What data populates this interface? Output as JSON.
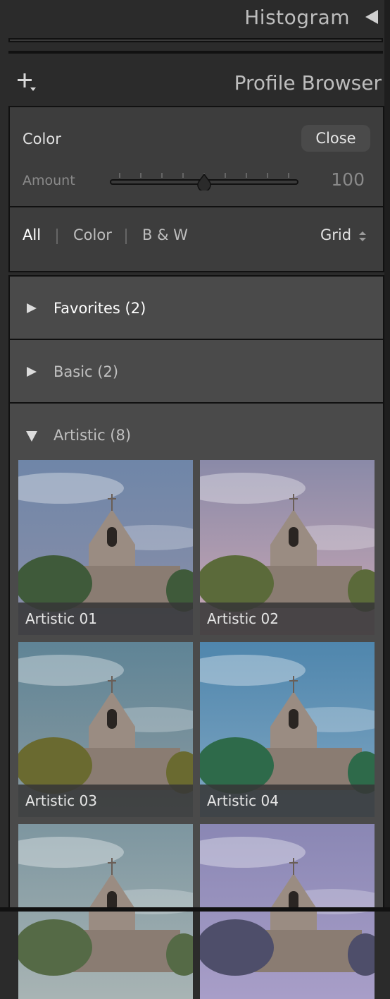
{
  "histogram": {
    "title": "Histogram"
  },
  "profile_browser": {
    "title": "Profile Browser",
    "current_profile": "Color",
    "close_label": "Close",
    "amount_label": "Amount",
    "amount_value": "100",
    "amount_fraction": 0.5,
    "filters": [
      "All",
      "Color",
      "B & W"
    ],
    "active_filter": "All",
    "view_mode": "Grid"
  },
  "groups": [
    {
      "label": "Favorites (2)",
      "expanded": false
    },
    {
      "label": "Basic (2)",
      "expanded": false
    },
    {
      "label": "Artistic (8)",
      "expanded": true
    }
  ],
  "thumbnails": [
    {
      "label": "Artistic 01",
      "sky": "#6f86a8",
      "tint": "#8b8fa8",
      "foliage": "#3f5a3a"
    },
    {
      "label": "Artistic 02",
      "sky": "#8a8aa8",
      "tint": "#c9a7b4",
      "foliage": "#5b6a3a"
    },
    {
      "label": "Artistic 03",
      "sky": "#5f8496",
      "tint": "#8a9aa0",
      "foliage": "#6a6a30"
    },
    {
      "label": "Artistic 04",
      "sky": "#4f86ad",
      "tint": "#7fa6c2",
      "foliage": "#2e6a4a"
    },
    {
      "label": "",
      "sky": "#7d96a0",
      "tint": "#a8b4b4",
      "foliage": "#556a46"
    },
    {
      "label": "",
      "sky": "#8a87b4",
      "tint": "#a89ec8",
      "foliage": "#4e4e6a"
    }
  ]
}
